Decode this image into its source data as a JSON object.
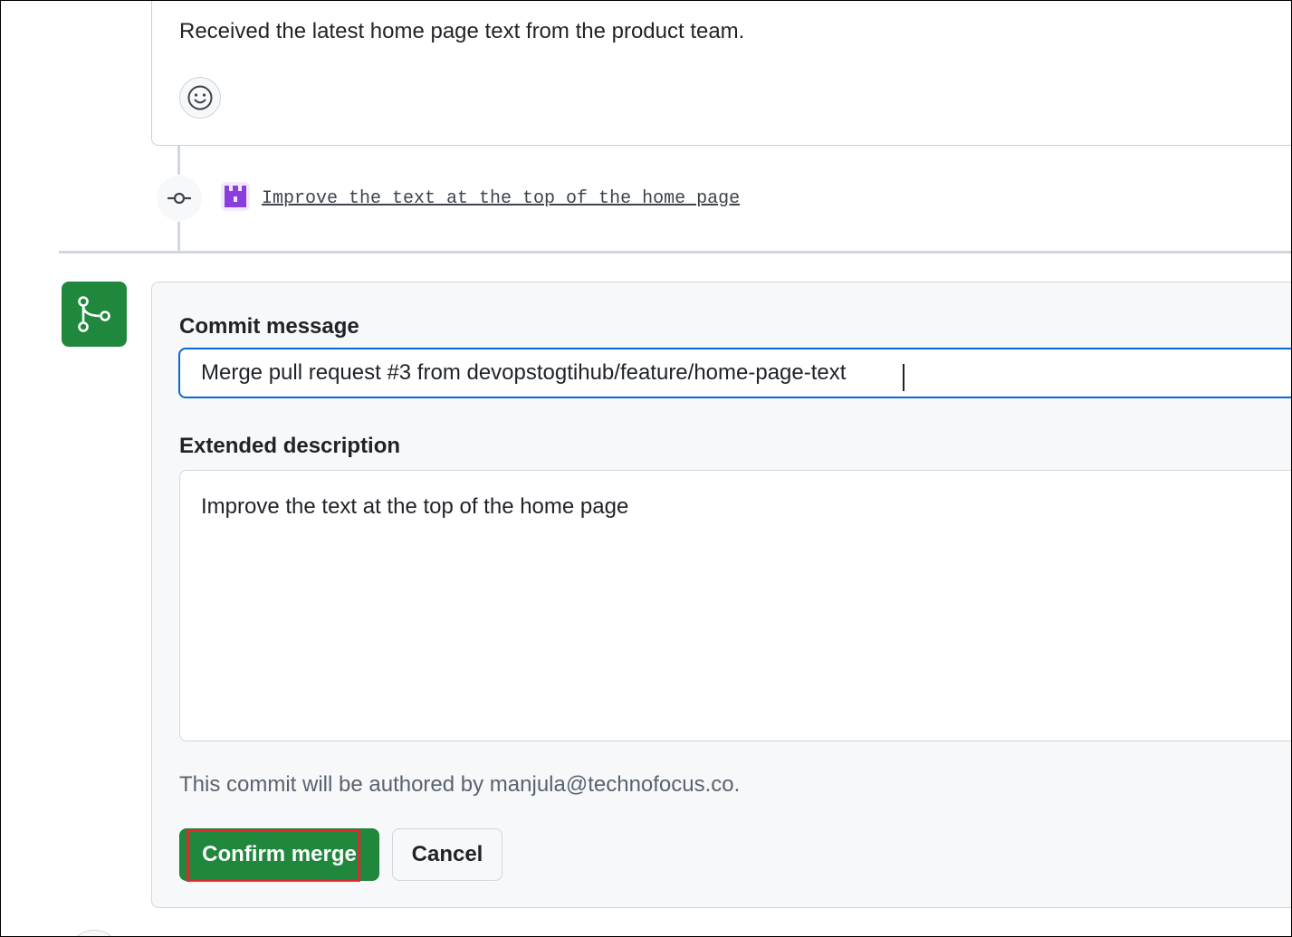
{
  "comment": {
    "text": "Received the latest home page text from the product team.",
    "reaction_icon": "smiley-icon"
  },
  "timeline": {
    "commit_icon": "git-commit-icon",
    "avatar_icon": "identicon-avatar",
    "commit_message": "Improve the text at the top of the home page"
  },
  "merge": {
    "icon": "git-merge-icon",
    "commit_message_label": "Commit message",
    "commit_message_value": "Merge pull request #3 from devopstogtihub/feature/home-page-text",
    "extended_description_label": "Extended description",
    "extended_description_value": "Improve the text at the top of the home page",
    "author_note": "This commit will be authored by manjula@technofocus.co.",
    "confirm_label": "Confirm merge",
    "cancel_label": "Cancel"
  },
  "colors": {
    "merge_green": "#1f883d",
    "focus_blue": "#0969da",
    "highlight_red": "#e0282e",
    "avatar_purple": "#8a3ee0"
  }
}
